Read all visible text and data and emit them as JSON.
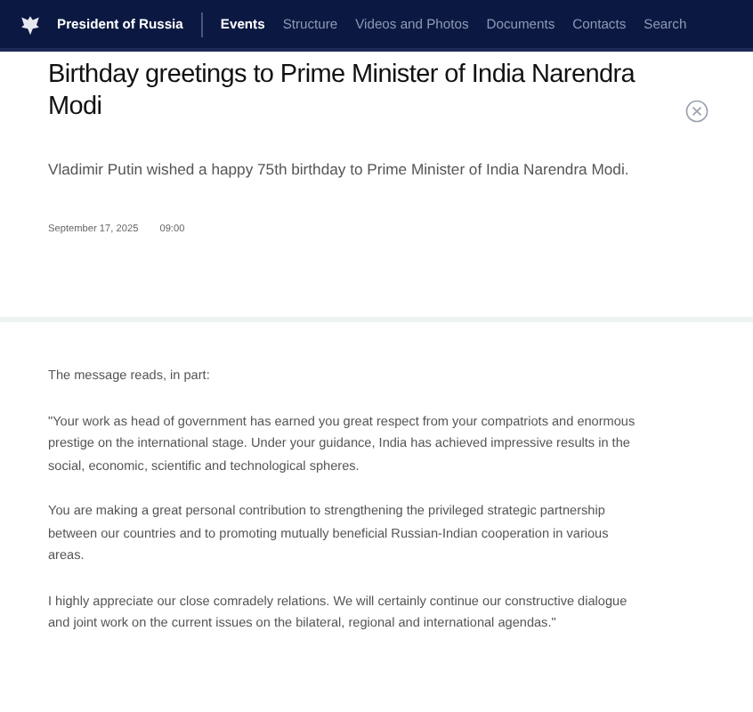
{
  "header": {
    "site_title": "President of Russia",
    "nav": [
      {
        "label": "Events",
        "selected": true
      },
      {
        "label": "Structure",
        "selected": false
      },
      {
        "label": "Videos and Photos",
        "selected": false
      },
      {
        "label": "Documents",
        "selected": false
      },
      {
        "label": "Contacts",
        "selected": false
      },
      {
        "label": "Search",
        "selected": false
      }
    ]
  },
  "article": {
    "title": "Birthday greetings to Prime Minister of India Narendra Modi",
    "lead": "Vladimir Putin wished a happy 75th birthday to Prime Minister of India Narendra Modi.",
    "date": "September 17, 2025",
    "time": "09:00",
    "paragraphs": [
      "The message reads, in part:",
      "\"Your work as head of government has earned you great respect from your compatriots and enormous prestige on the international stage. Under your guidance, India has achieved impressive results in the social, economic, scientific and technological spheres.",
      "You are making a great personal contribution to strengthening the privileged strategic partnership between our countries and to promoting mutually beneficial Russian-Indian cooperation in various areas.",
      "I highly appreciate our close comradely relations. We will certainly continue our constructive dialogue and joint work on the current issues on the bilateral, regional and international agendas.\""
    ]
  }
}
